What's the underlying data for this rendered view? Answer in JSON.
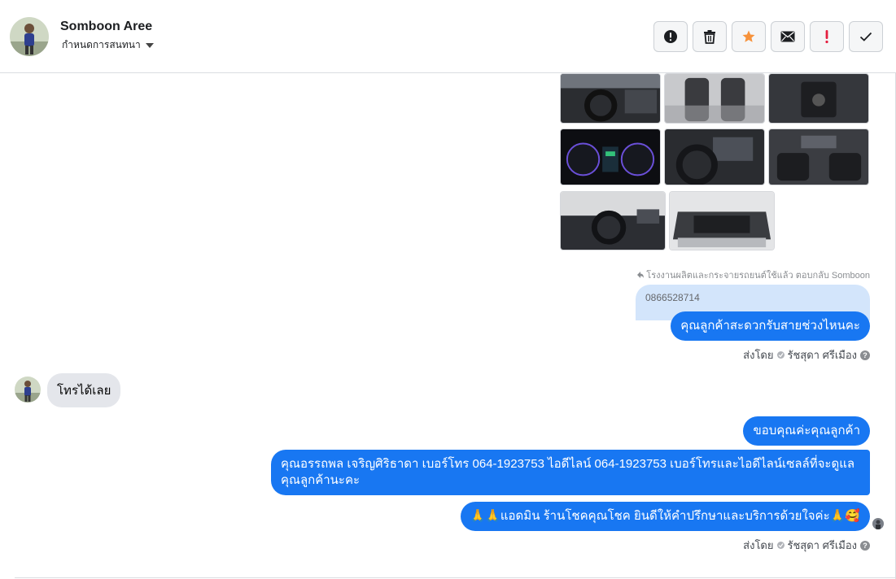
{
  "header": {
    "contact_name": "Somboon Aree",
    "conversation_settings": "กำหนดการสนทนา",
    "toolbar": [
      {
        "name": "alert-button",
        "icon": "exclamation-circle-icon"
      },
      {
        "name": "delete-button",
        "icon": "trash-icon"
      },
      {
        "name": "star-button",
        "icon": "star-icon",
        "color": "#f7923b"
      },
      {
        "name": "mail-button",
        "icon": "envelope-icon"
      },
      {
        "name": "spam-button",
        "icon": "exclamation-icon",
        "color": "#e41e3f"
      },
      {
        "name": "done-button",
        "icon": "check-icon"
      }
    ]
  },
  "messages": {
    "reply_note": "โรงงานผลิตและกระจายรถยนต์ใช้แล้ว ตอบกลับ Somboon",
    "quoted_text": "0866528714",
    "outgoing_1": "คุณลูกค้าสะดวกรับสายช่วงไหนคะ",
    "sent_by_1": "ส่งโดย",
    "sender_1": "รัชสุดา ศรีเมือง",
    "incoming_1": "โทรได้เลย",
    "outgoing_2": "ขอบคุณค่ะคุณลูกค้า",
    "outgoing_3": "คุณอรรถพล เจริญศิริธาดา      เบอร์โทร 064-1923753 ไอดีไลน์ 064-1923753   เบอร์โทรและไอดีไลน์เซลล์ที่จะดูแลคุณลูกค้านะคะ",
    "outgoing_4": "🙏🙏แอดมิน ร้านโชคคุณโชค ยินดีให้คำปรึกษาและบริการด้วยใจค่ะ🙏🥰",
    "sent_by_2": "ส่งโดย",
    "sender_2": "รัชสุดา ศรีเมือง",
    "help_glyph": "?"
  },
  "colors": {
    "outgoing_bubble": "#1877f2",
    "incoming_bubble": "#e4e6eb",
    "quoted_bubble": "#d3e5fb"
  }
}
